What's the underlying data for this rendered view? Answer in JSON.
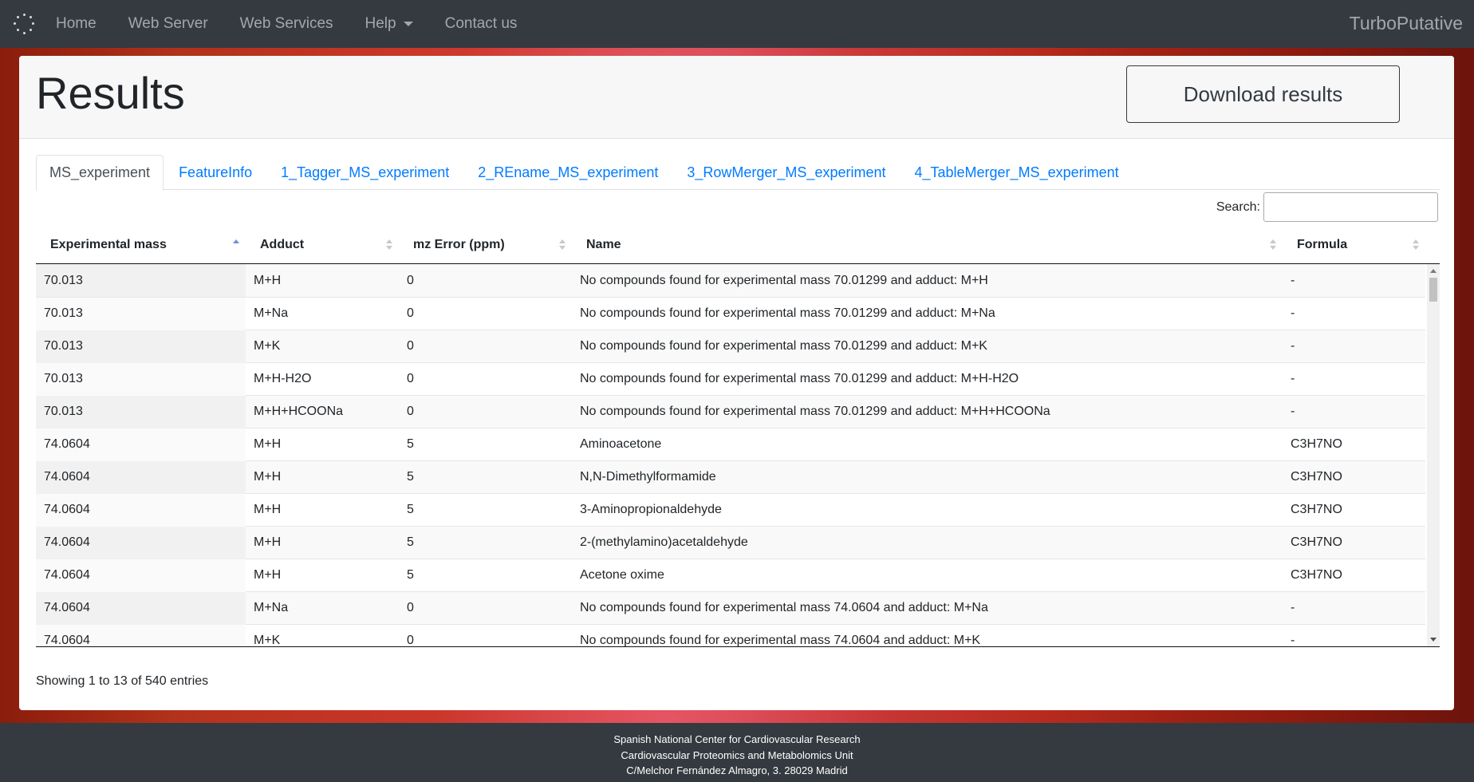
{
  "navbar": {
    "links": [
      "Home",
      "Web Server",
      "Web Services",
      "Help",
      "Contact us"
    ],
    "brand": "TurboPutative"
  },
  "header": {
    "title": "Results",
    "download_label": "Download results"
  },
  "tabs": [
    "MS_experiment",
    "FeatureInfo",
    "1_Tagger_MS_experiment",
    "2_REname_MS_experiment",
    "3_RowMerger_MS_experiment",
    "4_TableMerger_MS_experiment"
  ],
  "search": {
    "label": "Search:",
    "value": ""
  },
  "table": {
    "columns": [
      "Experimental mass",
      "Adduct",
      "mz Error (ppm)",
      "Name",
      "Formula"
    ],
    "sorted_column": "Experimental mass",
    "sort_direction": "ascending",
    "rows": [
      [
        "70.013",
        "M+H",
        "0",
        "No compounds found for experimental mass 70.01299 and adduct: M+H",
        "-"
      ],
      [
        "70.013",
        "M+Na",
        "0",
        "No compounds found for experimental mass 70.01299 and adduct: M+Na",
        "-"
      ],
      [
        "70.013",
        "M+K",
        "0",
        "No compounds found for experimental mass 70.01299 and adduct: M+K",
        "-"
      ],
      [
        "70.013",
        "M+H-H2O",
        "0",
        "No compounds found for experimental mass 70.01299 and adduct: M+H-H2O",
        "-"
      ],
      [
        "70.013",
        "M+H+HCOONa",
        "0",
        "No compounds found for experimental mass 70.01299 and adduct: M+H+HCOONa",
        "-"
      ],
      [
        "74.0604",
        "M+H",
        "5",
        "Aminoacetone",
        "C3H7NO"
      ],
      [
        "74.0604",
        "M+H",
        "5",
        "N,N-Dimethylformamide",
        "C3H7NO"
      ],
      [
        "74.0604",
        "M+H",
        "5",
        "3-Aminopropionaldehyde",
        "C3H7NO"
      ],
      [
        "74.0604",
        "M+H",
        "5",
        "2-(methylamino)acetaldehyde",
        "C3H7NO"
      ],
      [
        "74.0604",
        "M+H",
        "5",
        "Acetone oxime",
        "C3H7NO"
      ],
      [
        "74.0604",
        "M+Na",
        "0",
        "No compounds found for experimental mass 74.0604 and adduct: M+Na",
        "-"
      ],
      [
        "74.0604",
        "M+K",
        "0",
        "No compounds found for experimental mass 74.0604 and adduct: M+K",
        "-"
      ]
    ]
  },
  "info": "Showing 1 to 13 of 540 entries",
  "footer": {
    "lines": [
      "Spanish National Center for Cardiovascular Research",
      "Cardiovascular Proteomics and Metabolomics Unit",
      "C/Melchor Fernández Almagro, 3. 28029 Madrid"
    ]
  },
  "colors": {
    "navbar": "#343a40",
    "link": "#007bff",
    "sort_active": "#6f8fd8"
  }
}
